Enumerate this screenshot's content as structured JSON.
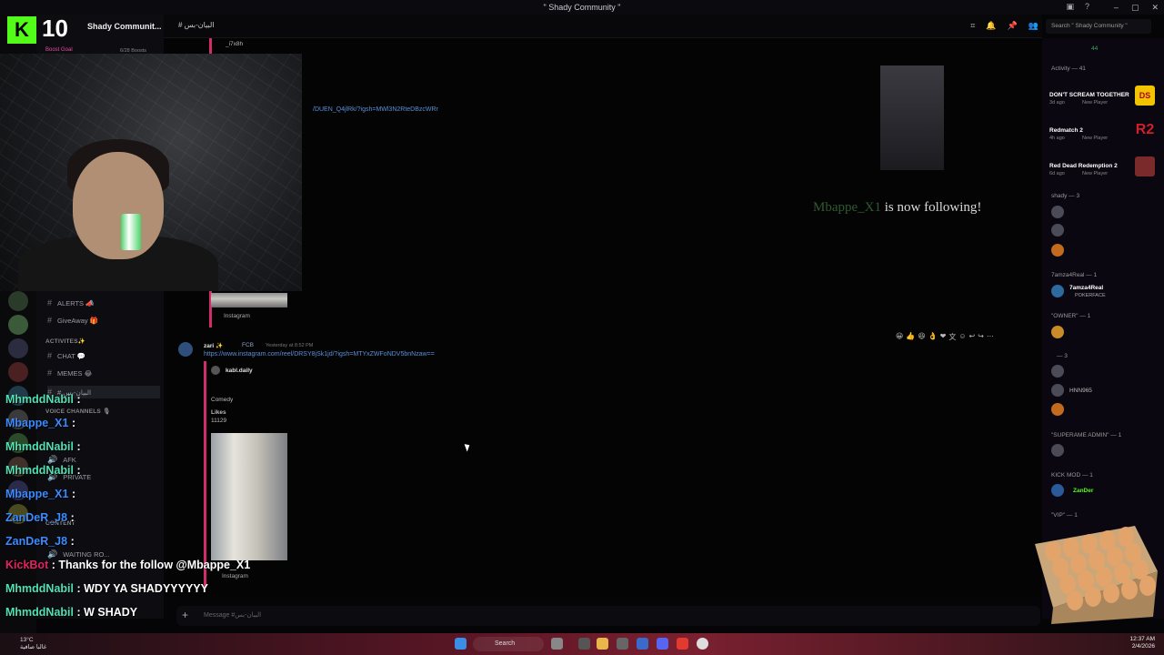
{
  "window": {
    "title": "\" Shady Community \""
  },
  "server": {
    "name": "Shady Communit...",
    "boost_goal": "Boost Goal",
    "boost_count": "6/28 Boosts"
  },
  "channels": {
    "alerts": "ALERTS 📣",
    "giveaway": "GiveAway 🎁",
    "activities_cat": "ACTIVITES✨",
    "chat": "CHAT 💬",
    "memes": "MEMES 😂",
    "voice_cat": "VOICE CHANNELS 🎙",
    "afk": "AFK",
    "private": "PRIVATE",
    "content": "CONTENT",
    "waiting": "WAITING RO..."
  },
  "header": {
    "channel": "# البيان-بس",
    "search_placeholder": "Search \" Shady Community \""
  },
  "messages": {
    "embed1_author": "_i7x8h",
    "embed1_link": "/DUEN_Q4jlRk/?igsh=MWl3N2RteDBzcWRr",
    "embed1_source": "Instagram",
    "msg2_author": "zari ✨",
    "msg2_tag": "FCB",
    "msg2_time": "Yesterday at 8:52 PM",
    "msg2_link": "https://www.instagram.com/reel/DRSY8jSk1jd/?igsh=MTYxZWFoNDV5bnNzaw==",
    "embed2_author": "kabl.daily",
    "embed2_title": "Comedy",
    "embed2_likes_label": "Likes",
    "embed2_likes": "11129",
    "embed2_source": "Instagram"
  },
  "composer": {
    "placeholder": "Message #البيان-بس"
  },
  "members": {
    "activity_header": "Activity — 41",
    "online_count": "44",
    "games": [
      {
        "title": "DON'T SCREAM TOGETHER",
        "time": "3d ago",
        "status": "New Player",
        "badge": "DS",
        "color": "#f2c400"
      },
      {
        "title": "Redmatch 2",
        "time": "4h ago",
        "status": "New Player",
        "badge": "R2",
        "color": "#d21f2b"
      },
      {
        "title": "Red Dead Redemption 2",
        "time": "6d ago",
        "status": "New Player",
        "badge": "",
        "color": "#7a2a2a"
      }
    ],
    "shady_header": "shady — 3",
    "tamza_header": "7amza4Real — 1",
    "tamza_name": "7amza4Real",
    "tamza_sub": "POKERFACE",
    "owner_header": "\"OWNER\" — 1",
    "section3_header": "— 3",
    "hnn": "HNN965",
    "supreme_header": "\"SUPERAME ADMIN\" — 1",
    "kickmod_header": "KICK MOD — 1",
    "zander": "ZanDer",
    "vip_header": "\"VIP\" — 1"
  },
  "stream": {
    "kick_count": "10",
    "follow_user": "Mbappe_X1",
    "follow_text": "is now following!",
    "chat": [
      {
        "user": "MhmddNabil",
        "sep": " :",
        "msg": "",
        "cls": "u1"
      },
      {
        "user": "Mbappe_X1",
        "sep": " :",
        "msg": "",
        "cls": "u2"
      },
      {
        "user": "MhmddNabil",
        "sep": " :",
        "msg": "",
        "cls": "u1"
      },
      {
        "user": "MhmddNabil",
        "sep": " :",
        "msg": "",
        "cls": "u1"
      },
      {
        "user": "Mbappe_X1",
        "sep": " :",
        "msg": "",
        "cls": "u2"
      },
      {
        "user": "ZanDeR_J8",
        "sep": " :",
        "msg": "",
        "cls": "u2"
      },
      {
        "user": "ZanDeR_J8",
        "sep": " :",
        "msg": "",
        "cls": "u2"
      },
      {
        "user": "KickBot",
        "sep": " :",
        "msg": " Thanks for the follow @Mbappe_X1",
        "cls": "u3"
      },
      {
        "user": "MhmddNabil",
        "sep": " :",
        "msg": " WDY YA SHADYYYYYY",
        "cls": "u1"
      },
      {
        "user": "MhmddNabil",
        "sep": " :",
        "msg": " W SHADY",
        "cls": "u1"
      }
    ]
  },
  "taskbar": {
    "search": "Search",
    "temp": "13°C",
    "weather": "غالبا صافية",
    "time": "12:37 AM",
    "date": "2/4/2026"
  }
}
